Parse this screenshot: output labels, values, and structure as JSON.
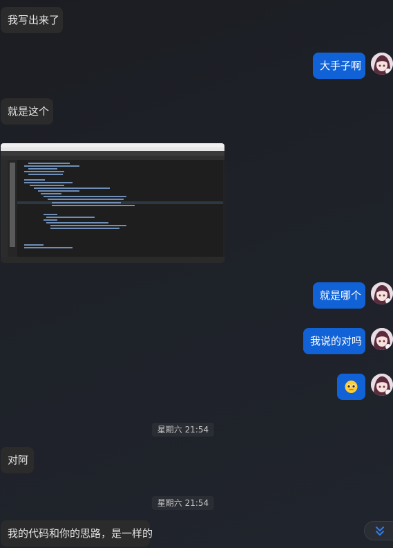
{
  "messages": [
    {
      "id": "m1",
      "side": "in",
      "text": "我写出来了"
    },
    {
      "id": "m2",
      "side": "out",
      "text": "大手子啊"
    },
    {
      "id": "m3",
      "side": "in",
      "text": "就是这个"
    },
    {
      "id": "m4",
      "side": "in",
      "type": "image",
      "image_title": "code editor screenshot"
    },
    {
      "id": "m5",
      "side": "out",
      "text": "就是哪个"
    },
    {
      "id": "m6",
      "side": "out",
      "text": "我说的对吗"
    },
    {
      "id": "m7",
      "side": "out",
      "type": "emoji",
      "emoji": "🥺"
    },
    {
      "id": "t1",
      "type": "time",
      "text": "星期六 21:54"
    },
    {
      "id": "m8",
      "side": "in",
      "text": "对阿"
    },
    {
      "id": "t2",
      "type": "time",
      "text": "星期六 21:54"
    },
    {
      "id": "m9",
      "side": "in",
      "text": "我的代码和你的思路，是一样的"
    }
  ],
  "colors": {
    "bubble_in": "#2b2b2b",
    "bubble_out": "#1062d6",
    "background": "#1e2128"
  },
  "icons": {
    "scroll_down": "double-chevron-down-icon",
    "avatar": "anime-girl-avatar"
  }
}
